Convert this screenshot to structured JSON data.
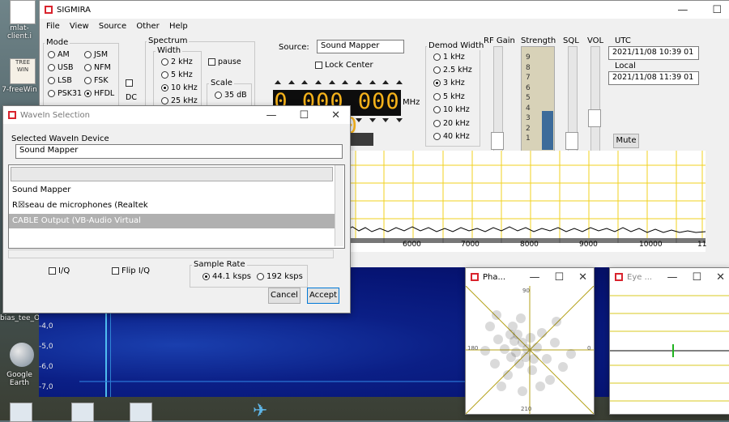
{
  "desktop": {
    "icons": [
      {
        "label": "mlat-client.i"
      },
      {
        "label": "7-freeWin"
      },
      {
        "label": "bias_tee_O"
      },
      {
        "label": "Google Earth"
      }
    ],
    "badge": "TREE WIN"
  },
  "main": {
    "title": "SIGMIRA",
    "menu": [
      "File",
      "View",
      "Source",
      "Other",
      "Help"
    ],
    "mode": {
      "label": "Mode",
      "options": [
        "AM",
        "JSM",
        "USB",
        "NFM",
        "LSB",
        "FSK",
        "PSK31",
        "HFDL",
        "PSK"
      ],
      "selected": "HFDL",
      "dc_label": "DC"
    },
    "spectrum": {
      "label": "Spectrum",
      "width_label": "Width",
      "width_options": [
        "2 kHz",
        "5 kHz",
        "10 kHz",
        "25 kHz"
      ],
      "width_selected": "10 kHz",
      "pause_label": "pause",
      "scale_label": "Scale",
      "scale_options": [
        "35 dB"
      ]
    },
    "source": {
      "label": "Source:",
      "value": "Sound Mapper",
      "lock_label": "Lock Center"
    },
    "frequency": {
      "value": "0.000 000 000",
      "unit": "MHz"
    },
    "demod": {
      "label": "Demod Width",
      "options": [
        "1 kHz",
        "2.5 kHz",
        "3 kHz",
        "5 kHz",
        "10 kHz",
        "20 kHz",
        "40 kHz"
      ],
      "selected": "3 kHz"
    },
    "meters": {
      "rf_gain": "RF Gain",
      "strength": "Strength",
      "sql": "SQL",
      "vol": "VOL",
      "strength_ticks": [
        "9",
        "8",
        "7",
        "6",
        "5",
        "4",
        "3",
        "2",
        "1"
      ],
      "strength_level": 0.33
    },
    "time": {
      "utc_label": "UTC",
      "utc_value": "2021/11/08  10:39 01",
      "local_label": "Local",
      "local_value": "2021/11/08  11:39 01"
    },
    "mute_label": "Mute",
    "freq_axis": [
      "6000",
      "7000",
      "8000",
      "9000",
      "10000",
      "11"
    ],
    "waterfall_ticks": [
      "-4,0",
      "-5,0",
      "-6,0",
      "-7,0"
    ]
  },
  "wavein": {
    "title": "WaveIn Selection",
    "device_label": "Selected WaveIn Device",
    "device_value": "Sound Mapper",
    "list": [
      "Sound Mapper",
      "R☒seau de microphones (Realtek",
      "CABLE Output (VB-Audio Virtual"
    ],
    "selected_index": 2,
    "iq_label": "I/Q",
    "flip_label": "Flip I/Q",
    "rate_label": "Sample Rate",
    "rates": [
      "44.1 ksps",
      "192 ksps"
    ],
    "rate_selected": "44.1 ksps",
    "cancel": "Cancel",
    "accept": "Accept"
  },
  "phase": {
    "title": "Pha...",
    "labels": [
      "90",
      "180",
      "0",
      "210"
    ]
  },
  "eye": {
    "title": "Eye ..."
  }
}
